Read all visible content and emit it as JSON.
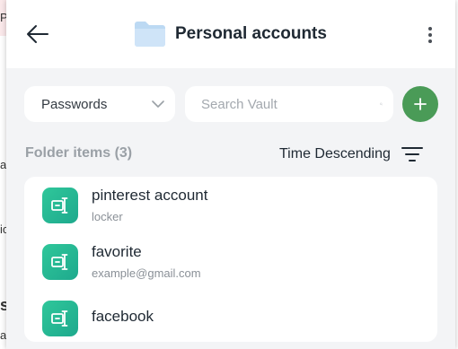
{
  "background": {
    "chars": [
      "P",
      "a",
      "ic",
      "s",
      "a"
    ]
  },
  "header": {
    "title": "Personal accounts",
    "back_icon": "arrow-left-icon",
    "folder_icon": "folder-icon",
    "menu_icon": "more-vertical-icon"
  },
  "filters": {
    "type_select": "Passwords",
    "search_placeholder": "Search Vault",
    "add_icon": "plus-icon"
  },
  "folder": {
    "count_label": "Folder items (3)",
    "sort_label": "Time Descending"
  },
  "items": [
    {
      "name": "pinterest account",
      "sub": "locker"
    },
    {
      "name": "favorite",
      "sub": "example@gmail.com"
    },
    {
      "name": "facebook",
      "sub": ""
    }
  ],
  "colors": {
    "accent": "#4a9b57",
    "item_icon": "#25b893",
    "panel_bg": "#f3f4f6",
    "folder": "#bcd9f3"
  }
}
